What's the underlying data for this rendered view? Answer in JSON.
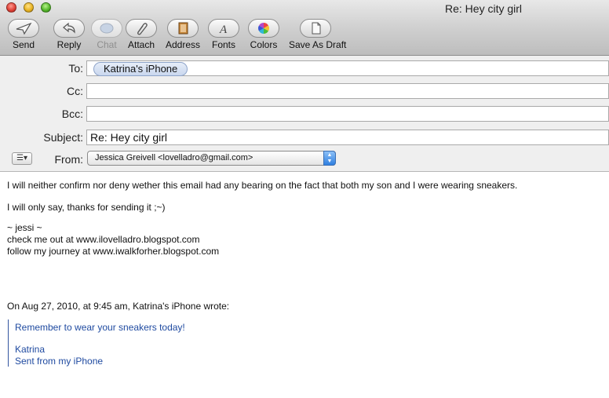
{
  "window": {
    "title": "Re: Hey city girl"
  },
  "toolbar": {
    "send": "Send",
    "reply": "Reply",
    "chat": "Chat",
    "attach": "Attach",
    "address": "Address",
    "fonts": "Fonts",
    "colors": "Colors",
    "save_as_draft": "Save As Draft"
  },
  "header": {
    "to_label": "To:",
    "to_recipient": "Katrina's iPhone",
    "cc_label": "Cc:",
    "bcc_label": "Bcc:",
    "subject_label": "Subject:",
    "subject_value": "Re: Hey city girl",
    "from_label": "From:",
    "from_value": "Jessica Greivell <lovelladro@gmail.com>",
    "list_button": "☰▾"
  },
  "body": {
    "line1": "I will neither confirm nor deny wether this email had any bearing on the fact that both my son and I were wearing sneakers.",
    "line2": "I will only say, thanks for sending it ;~)",
    "sig1": "~ jessi ~",
    "sig2": "check me out at www.ilovelladro.blogspot.com",
    "sig3": "follow my journey at www.iwalkforher.blogspot.com",
    "attribution": "On Aug 27, 2010, at 9:45 am, Katrina's iPhone wrote:",
    "quote1": "Remember to wear your sneakers today!",
    "quote2": "Katrina",
    "quote3": "Sent from my iPhone"
  },
  "colors": {
    "quote_text": "#1f4aa0",
    "quote_bar": "#3355a0"
  }
}
